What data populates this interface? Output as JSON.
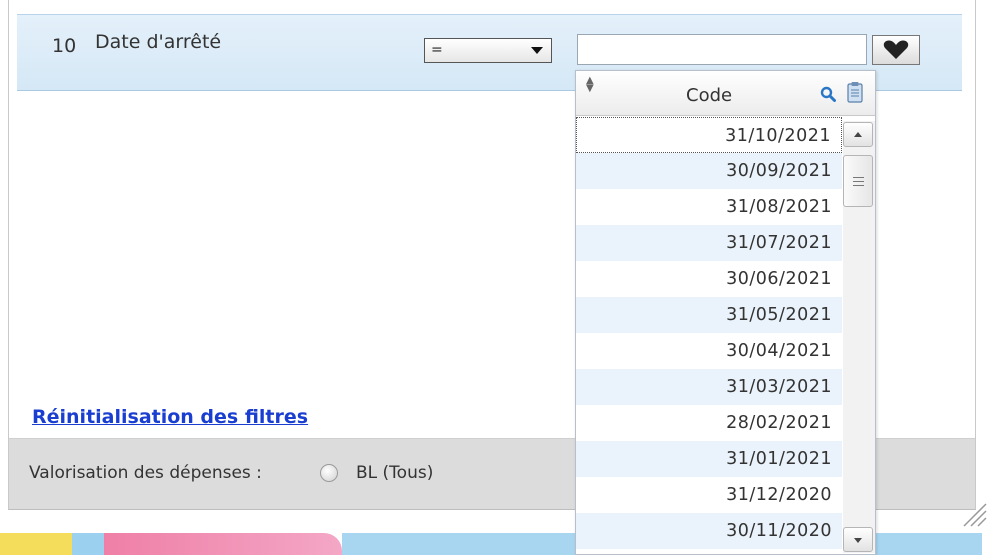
{
  "filter": {
    "row_number": "10",
    "label": "Date d'arrêté",
    "operator": "=",
    "value": ""
  },
  "dropdown": {
    "column_header": "Code",
    "items": [
      "31/10/2021",
      "30/09/2021",
      "31/08/2021",
      "31/07/2021",
      "30/06/2021",
      "31/05/2021",
      "30/04/2021",
      "31/03/2021",
      "28/02/2021",
      "31/01/2021",
      "31/12/2020",
      "30/11/2020"
    ]
  },
  "reset_link": "Réinitialisation des filtres",
  "footer": {
    "label": "Valorisation des dépenses :",
    "radio_label": "BL (Tous)"
  },
  "icons": {
    "heart": "heart-icon",
    "search": "search-icon",
    "clipboard": "clipboard-icon",
    "sort": "sort-icon"
  },
  "colors": {
    "filter_row_bg": "#dbeaf7",
    "link": "#1a3fd0",
    "footer_bg": "#dcdcdc",
    "search_icon": "#2a76c6",
    "alt_row": "#eaf3fb"
  }
}
